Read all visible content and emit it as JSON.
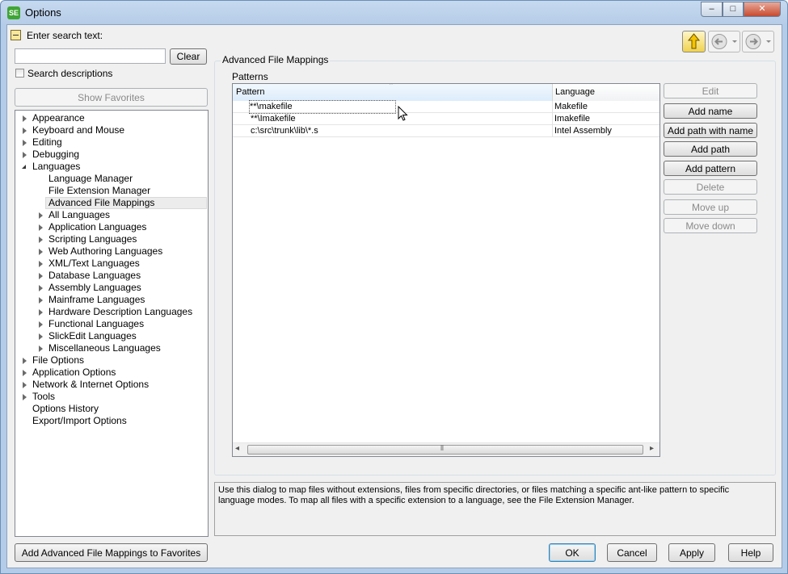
{
  "window": {
    "title": "Options",
    "icon_text": "SE"
  },
  "titlebar_buttons": {
    "minimize": "–",
    "maximize": "□",
    "close": "✕"
  },
  "search": {
    "label": "Enter search text:",
    "value": "",
    "clear_label": "Clear",
    "search_descriptions_label": "Search descriptions",
    "show_favorites_label": "Show Favorites"
  },
  "tree": {
    "items": [
      {
        "label": "Appearance",
        "level": 0,
        "expander": "closed"
      },
      {
        "label": "Keyboard and Mouse",
        "level": 0,
        "expander": "closed"
      },
      {
        "label": "Editing",
        "level": 0,
        "expander": "closed"
      },
      {
        "label": "Debugging",
        "level": 0,
        "expander": "closed"
      },
      {
        "label": "Languages",
        "level": 0,
        "expander": "open"
      },
      {
        "label": "Language Manager",
        "level": 1,
        "expander": "none"
      },
      {
        "label": "File Extension Manager",
        "level": 1,
        "expander": "none"
      },
      {
        "label": "Advanced File Mappings",
        "level": 1,
        "expander": "none",
        "selected": true
      },
      {
        "label": "All Languages",
        "level": 1,
        "expander": "closed"
      },
      {
        "label": "Application Languages",
        "level": 1,
        "expander": "closed"
      },
      {
        "label": "Scripting Languages",
        "level": 1,
        "expander": "closed"
      },
      {
        "label": "Web Authoring Languages",
        "level": 1,
        "expander": "closed"
      },
      {
        "label": "XML/Text Languages",
        "level": 1,
        "expander": "closed"
      },
      {
        "label": "Database Languages",
        "level": 1,
        "expander": "closed"
      },
      {
        "label": "Assembly Languages",
        "level": 1,
        "expander": "closed"
      },
      {
        "label": "Mainframe Languages",
        "level": 1,
        "expander": "closed"
      },
      {
        "label": "Hardware Description Languages",
        "level": 1,
        "expander": "closed"
      },
      {
        "label": "Functional Languages",
        "level": 1,
        "expander": "closed"
      },
      {
        "label": "SlickEdit Languages",
        "level": 1,
        "expander": "closed"
      },
      {
        "label": "Miscellaneous Languages",
        "level": 1,
        "expander": "closed"
      },
      {
        "label": "File Options",
        "level": 0,
        "expander": "closed"
      },
      {
        "label": "Application Options",
        "level": 0,
        "expander": "closed"
      },
      {
        "label": "Network & Internet Options",
        "level": 0,
        "expander": "closed"
      },
      {
        "label": "Tools",
        "level": 0,
        "expander": "closed"
      },
      {
        "label": "Options History",
        "level": 0,
        "expander": "none"
      },
      {
        "label": "Export/Import Options",
        "level": 0,
        "expander": "none"
      }
    ]
  },
  "nav": {
    "up_icon": "up-arrow-icon",
    "back_icon": "back-arrow-icon",
    "forward_icon": "forward-arrow-icon"
  },
  "main": {
    "section_title": "Advanced File Mappings",
    "patterns_label": "Patterns",
    "columns": [
      "Pattern",
      "Language"
    ],
    "rows": [
      {
        "pattern": "**\\makefile",
        "language": "Makefile"
      },
      {
        "pattern": "**\\Imakefile",
        "language": "Imakefile"
      },
      {
        "pattern": "c:\\src\\trunk\\lib\\*.s",
        "language": "Intel Assembly"
      }
    ],
    "scroll_left": "◂",
    "scroll_right": "▸",
    "scroll_grip": "⦀",
    "sort_indicator": "ˆ",
    "buttons": [
      {
        "label": "Edit",
        "enabled": false
      },
      {
        "label": "Add name",
        "enabled": true
      },
      {
        "label": "Add path with name",
        "enabled": true
      },
      {
        "label": "Add path",
        "enabled": true
      },
      {
        "label": "Add pattern",
        "enabled": true
      },
      {
        "label": "Delete",
        "enabled": false
      },
      {
        "label": "Move up",
        "enabled": false
      },
      {
        "label": "Move down",
        "enabled": false
      }
    ],
    "description": "Use this dialog to map files without extensions, files from specific directories, or files matching a specific ant-like pattern to specific language modes. To map all files with a specific extension to a language, see the File Extension Manager."
  },
  "footer": {
    "add_favorites_label": "Add Advanced File Mappings to Favorites",
    "ok_label": "OK",
    "cancel_label": "Cancel",
    "apply_label": "Apply",
    "help_label": "Help"
  },
  "colors": {
    "accent": "#3c7fb1",
    "selection": "#ececec",
    "up_arrow": "#f5c400"
  }
}
